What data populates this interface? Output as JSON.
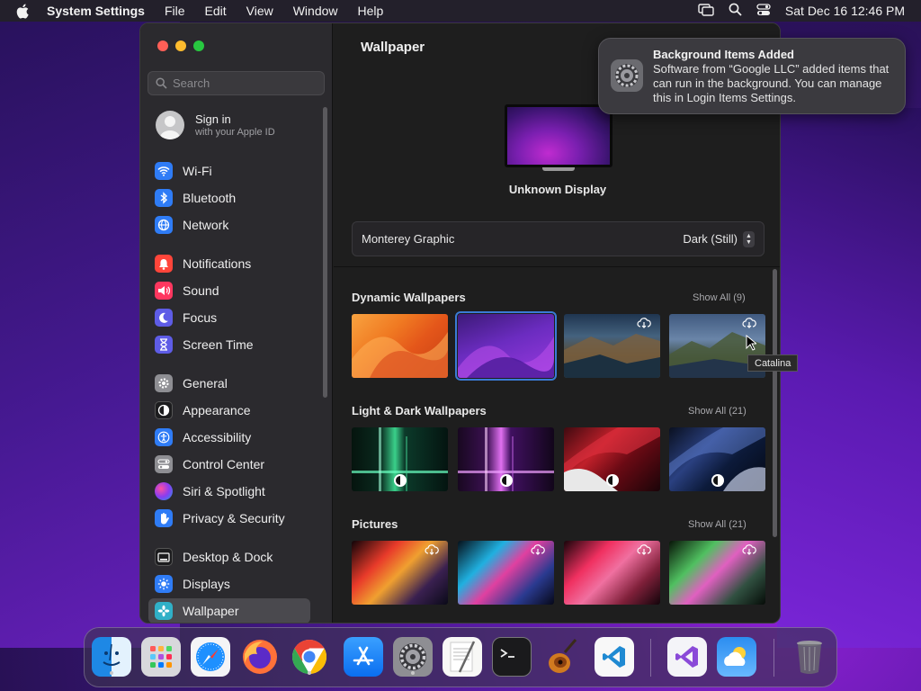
{
  "menubar": {
    "app_name": "System Settings",
    "items": [
      "File",
      "Edit",
      "View",
      "Window",
      "Help"
    ],
    "datetime": "Sat Dec 16  12:46 PM"
  },
  "sidebar": {
    "search_placeholder": "Search",
    "signin_title": "Sign in",
    "signin_subtitle": "with your Apple ID",
    "items": [
      {
        "label": "Wi-Fi",
        "icon": "wifi-icon",
        "color": "#2f7cf6"
      },
      {
        "label": "Bluetooth",
        "icon": "bluetooth-icon",
        "color": "#2f7cf6"
      },
      {
        "label": "Network",
        "icon": "globe-icon",
        "color": "#2f7cf6"
      },
      {
        "label": "Notifications",
        "icon": "bell-icon",
        "color": "#ff453a"
      },
      {
        "label": "Sound",
        "icon": "speaker-icon",
        "color": "#ff375f"
      },
      {
        "label": "Focus",
        "icon": "moon-icon",
        "color": "#5e5ce6"
      },
      {
        "label": "Screen Time",
        "icon": "hourglass-icon",
        "color": "#5e5ce6"
      },
      {
        "label": "General",
        "icon": "gear-icon",
        "color": "#8e8e93"
      },
      {
        "label": "Appearance",
        "icon": "appearance-icon",
        "color": "#1c1c1e"
      },
      {
        "label": "Accessibility",
        "icon": "accessibility-icon",
        "color": "#2f7cf6"
      },
      {
        "label": "Control Center",
        "icon": "control-center-icon",
        "color": "#8e8e93"
      },
      {
        "label": "Siri & Spotlight",
        "icon": "siri-icon",
        "color": "#bf5af2"
      },
      {
        "label": "Privacy & Security",
        "icon": "hand-icon",
        "color": "#2f7cf6"
      },
      {
        "label": "Desktop & Dock",
        "icon": "desktop-icon",
        "color": "#1c1c1e"
      },
      {
        "label": "Displays",
        "icon": "sun-icon",
        "color": "#2f7cf6"
      },
      {
        "label": "Wallpaper",
        "icon": "wallpaper-icon",
        "color": "#30b0c7"
      }
    ],
    "selected": "Wallpaper"
  },
  "content": {
    "title": "Wallpaper",
    "display_name": "Unknown Display",
    "wallpaper_name": "Monterey Graphic",
    "appearance_value": "Dark (Still)",
    "sections": [
      {
        "title": "Dynamic Wallpapers",
        "show_all": "Show All (9)"
      },
      {
        "title": "Light & Dark Wallpapers",
        "show_all": "Show All (21)"
      },
      {
        "title": "Pictures",
        "show_all": "Show All (21)"
      }
    ],
    "tooltip": "Catalina"
  },
  "notification": {
    "title": "Background Items Added",
    "body": "Software from “Google LLC” added items that can run in the background. You can manage this in Login Items Settings."
  },
  "dock": {
    "apps": [
      "Finder",
      "Launchpad",
      "Safari",
      "Firefox",
      "Chrome",
      "App Store",
      "System Settings",
      "TextEdit",
      "Terminal",
      "GarageBand",
      "Visual Studio Code",
      "Visual Studio",
      "Weather",
      "Trash"
    ]
  }
}
